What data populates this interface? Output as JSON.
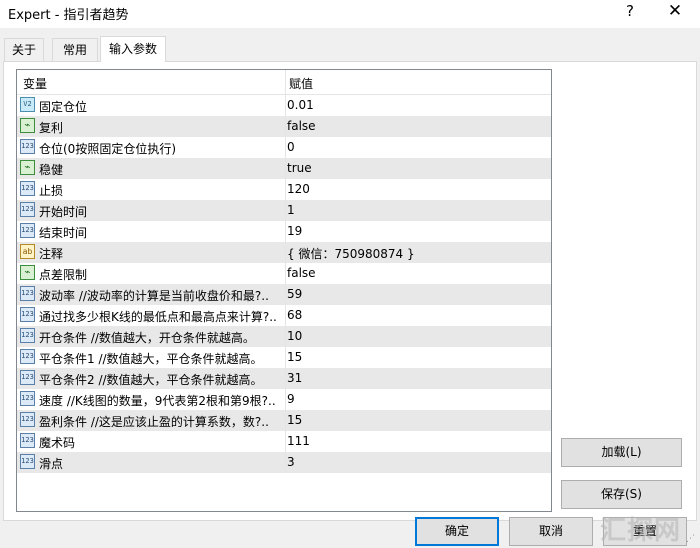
{
  "window": {
    "title": "Expert - 指引者趋势",
    "help": "?",
    "close": "✕"
  },
  "tabs": [
    {
      "label": "关于",
      "active": false
    },
    {
      "label": "常用",
      "active": false
    },
    {
      "label": "输入参数",
      "active": true
    }
  ],
  "grid": {
    "col_name": "变量",
    "col_value": "赋值",
    "rows": [
      {
        "icon": "double-icon",
        "icon_text": "V2",
        "name": "固定仓位",
        "value": "0.01"
      },
      {
        "icon": "bool-icon",
        "icon_text": "⌁",
        "name": "复利",
        "value": "false"
      },
      {
        "icon": "int-icon",
        "icon_text": "123",
        "name": "仓位(0按照固定仓位执行)",
        "value": "0"
      },
      {
        "icon": "bool-icon",
        "icon_text": "⌁",
        "name": "稳健",
        "value": "true"
      },
      {
        "icon": "int-icon",
        "icon_text": "123",
        "name": "止损",
        "value": "120"
      },
      {
        "icon": "int-icon",
        "icon_text": "123",
        "name": "开始时间",
        "value": "1"
      },
      {
        "icon": "int-icon",
        "icon_text": "123",
        "name": "结束时间",
        "value": "19"
      },
      {
        "icon": "string-icon",
        "icon_text": "ab",
        "name": "注释",
        "value": "{ 微信：750980874 }"
      },
      {
        "icon": "bool-icon",
        "icon_text": "⌁",
        "name": "点差限制",
        "value": "false"
      },
      {
        "icon": "int-icon",
        "icon_text": "123",
        "name": "波动率  //波动率的计算是当前收盘价和最?..",
        "value": "59"
      },
      {
        "icon": "int-icon",
        "icon_text": "123",
        "name": "通过找多少根K线的最低点和最高点来计算?..",
        "value": "68"
      },
      {
        "icon": "int-icon",
        "icon_text": "123",
        "name": "开仓条件  //数值越大，开仓条件就越高。",
        "value": "10"
      },
      {
        "icon": "int-icon",
        "icon_text": "123",
        "name": "平仓条件1  //数值越大，平仓条件就越高。",
        "value": "15"
      },
      {
        "icon": "int-icon",
        "icon_text": "123",
        "name": "平仓条件2  //数值越大，平仓条件就越高。",
        "value": "31"
      },
      {
        "icon": "int-icon",
        "icon_text": "123",
        "name": "速度  //K线图的数量，9代表第2根和第9根?..",
        "value": "9"
      },
      {
        "icon": "int-icon",
        "icon_text": "123",
        "name": "盈利条件  //这是应该止盈的计算系数，数?..",
        "value": "15"
      },
      {
        "icon": "int-icon",
        "icon_text": "123",
        "name": "魔术码",
        "value": "111"
      },
      {
        "icon": "int-icon",
        "icon_text": "123",
        "name": "滑点",
        "value": "3"
      }
    ]
  },
  "buttons": {
    "load": "加载(L)",
    "save": "保存(S)",
    "ok": "确定",
    "cancel": "取消",
    "reset": "重置"
  },
  "watermark": "汇探网"
}
